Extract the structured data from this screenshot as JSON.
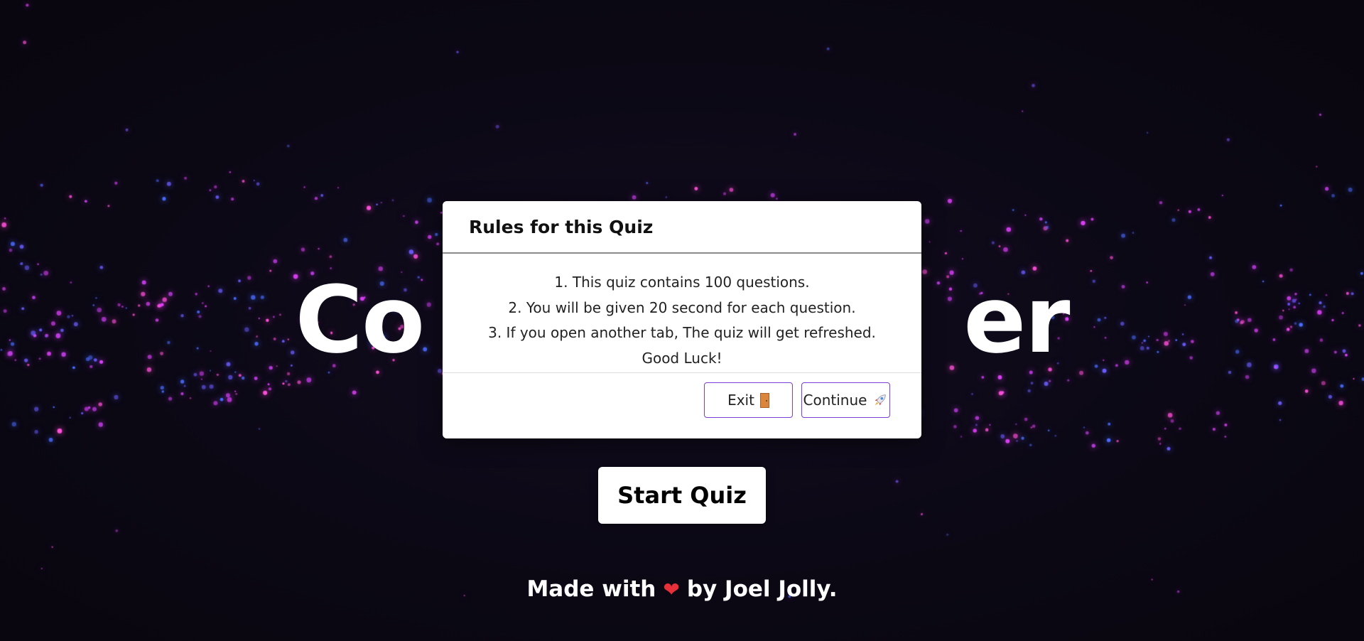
{
  "background": {
    "color": "#0b0814",
    "particle_colors": [
      "#e040fb",
      "#c23ce6",
      "#4a6cff",
      "#6a5cff",
      "#ff4fd8"
    ]
  },
  "hero": {
    "title_visible_left": "Co",
    "title_visible_right": "er"
  },
  "start_button": {
    "label": "Start Quiz"
  },
  "footer": {
    "prefix": "Made with",
    "heart_icon": "heart-icon",
    "heart_glyph": "❤",
    "suffix": "by Joel Jolly."
  },
  "modal": {
    "title": "Rules for this Quiz",
    "rules": [
      "1. This quiz contains 100 questions.",
      "2. You will be given 20 second for each question.",
      "3. If you open another tab, The quiz will get refreshed.",
      "Good Luck!"
    ],
    "exit_label": "Exit",
    "exit_icon": "door-icon",
    "continue_label": "Continue",
    "continue_icon": "rocket-icon",
    "accent_color": "#7a3fd6"
  }
}
